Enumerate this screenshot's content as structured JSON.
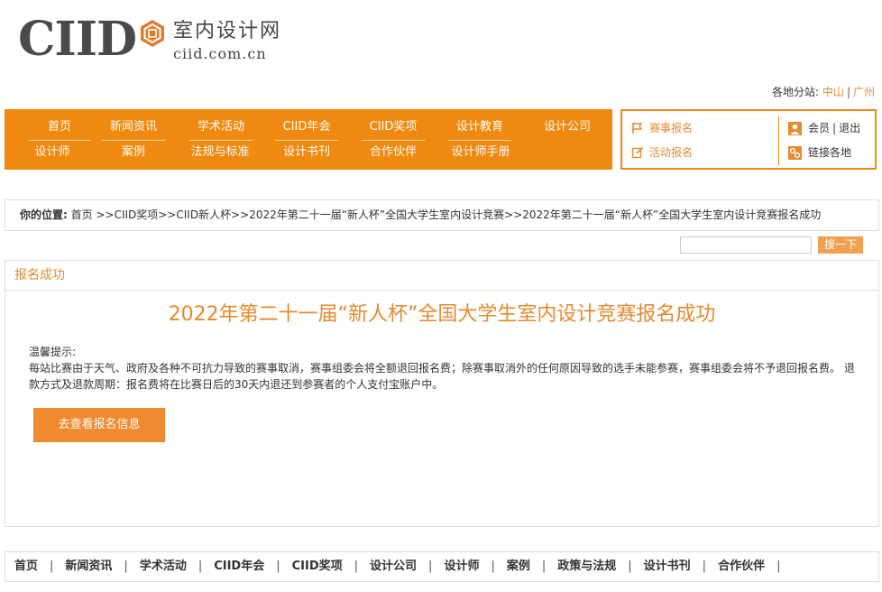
{
  "logo": {
    "brand": "CIID",
    "cn_name": "室内设计网",
    "url_text": "ciid.com.cn"
  },
  "branches": {
    "label": "各地分站:",
    "items": [
      "中山",
      "广州"
    ],
    "separator": "|"
  },
  "nav": {
    "row1": [
      "首页",
      "新闻资讯",
      "学术活动",
      "CIID年会",
      "CIID奖项",
      "设计教育",
      "设计公司"
    ],
    "row2": [
      "设计师",
      "案例",
      "法规与标准",
      "设计书刊",
      "合作伙伴",
      "设计师手册"
    ]
  },
  "sidebox": {
    "contest_signup": "赛事报名",
    "activity_signup": "活动报名",
    "member": "会员",
    "logout": "退出",
    "member_sep": "|",
    "link_branches": "链接各地"
  },
  "breadcrumb": {
    "label": "你的位置:",
    "path": "首页 >>CIID奖项>>CIID新人杯>>2022年第二十一届“新人杯”全国大学生室内设计竞赛>>2022年第二十一届“新人杯”全国大学生室内设计竞赛报名成功"
  },
  "search": {
    "value": "",
    "button_label": "搜一下"
  },
  "panel": {
    "header": "报名成功",
    "title": "2022年第二十一届“新人杯”全国大学生室内设计竞赛报名成功",
    "notice_title": "温馨提示:",
    "notice_body": "每站比赛由于天气、政府及各种不可抗力导致的赛事取消，赛事组委会将全额退回报名费；除赛事取消外的任何原因导致的选手未能参赛，赛事组委会将不予退回报名费。 退款方式及退款周期：报名费将在比赛日后的30天内退还到参赛者的个人支付宝账户中。",
    "view_button": "去查看报名信息"
  },
  "footer": {
    "items": [
      "首页",
      "新闻资讯",
      "学术活动",
      "CIID年会",
      "CIID奖项",
      "设计公司",
      "设计师",
      "案例",
      "政策与法规",
      "设计书刊",
      "合作伙伴"
    ],
    "separator": "|"
  },
  "colors": {
    "accent": "#f0890f",
    "accent_text": "#e68a2e",
    "border": "#dddddd"
  }
}
